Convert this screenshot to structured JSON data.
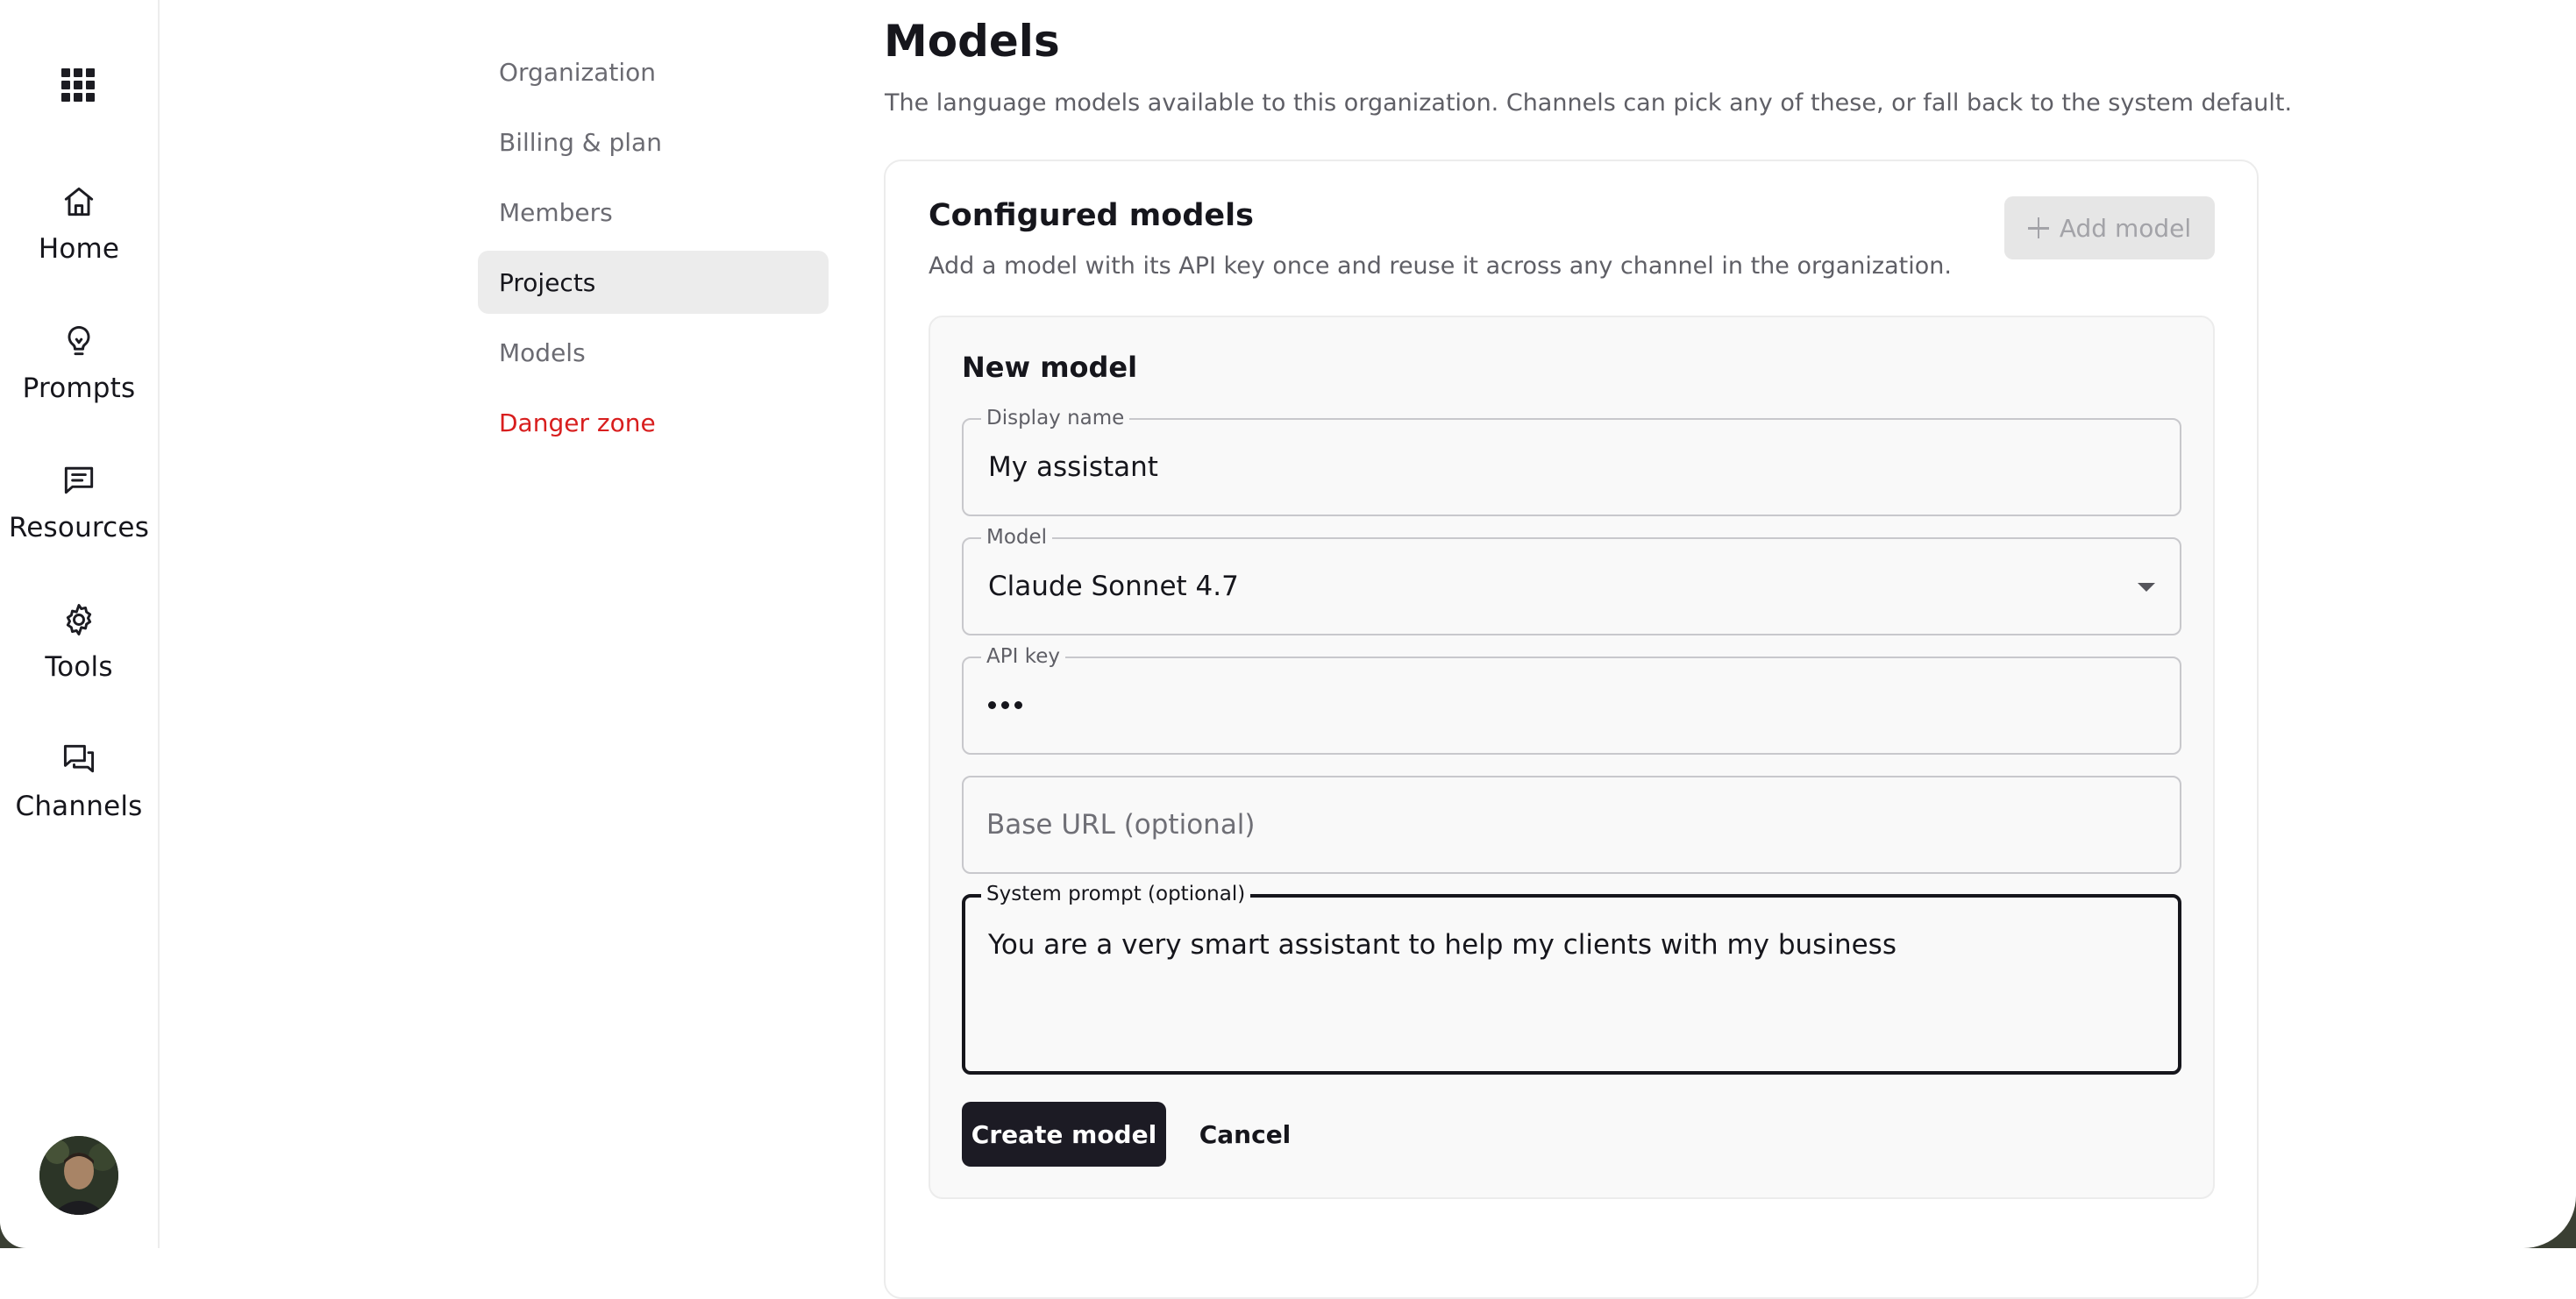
{
  "rail": {
    "apps_icon": "grid-icon",
    "items": [
      {
        "label": "Home",
        "icon": "home-icon"
      },
      {
        "label": "Prompts",
        "icon": "lightbulb-icon"
      },
      {
        "label": "Resources",
        "icon": "message-square-icon"
      },
      {
        "label": "Tools",
        "icon": "gear-icon"
      },
      {
        "label": "Channels",
        "icon": "chat-bubbles-icon"
      }
    ],
    "avatar": "user-avatar"
  },
  "settings_nav": {
    "items": [
      {
        "label": "Organization"
      },
      {
        "label": "Billing & plan"
      },
      {
        "label": "Members"
      },
      {
        "label": "Projects",
        "active": true
      },
      {
        "label": "Models"
      },
      {
        "label": "Danger zone",
        "danger": true
      }
    ]
  },
  "page": {
    "title": "Models",
    "description": "The language models available to this organization. Channels can pick any of these, or fall back to the system default."
  },
  "configured": {
    "title": "Configured models",
    "description": "Add a model with its API key once and reuse it across any channel in the organization.",
    "add_button": "Add model"
  },
  "form": {
    "title": "New model",
    "display_name": {
      "label": "Display name",
      "value": "My assistant"
    },
    "model": {
      "label": "Model",
      "value": "Claude Sonnet 4.7"
    },
    "api_key": {
      "label": "API key",
      "value_masked": "•••"
    },
    "base_url": {
      "placeholder": "Base URL (optional)",
      "value": ""
    },
    "system_prompt": {
      "label": "System prompt (optional)",
      "value": "You are a very smart assistant to help my clients with my business"
    },
    "create_button": "Create model",
    "cancel_button": "Cancel"
  },
  "colors": {
    "primary_button": "#1c1b24",
    "danger": "#d81e1e",
    "active_nav_bg": "#ececec",
    "disabled_button_bg": "#e6e6e6"
  }
}
